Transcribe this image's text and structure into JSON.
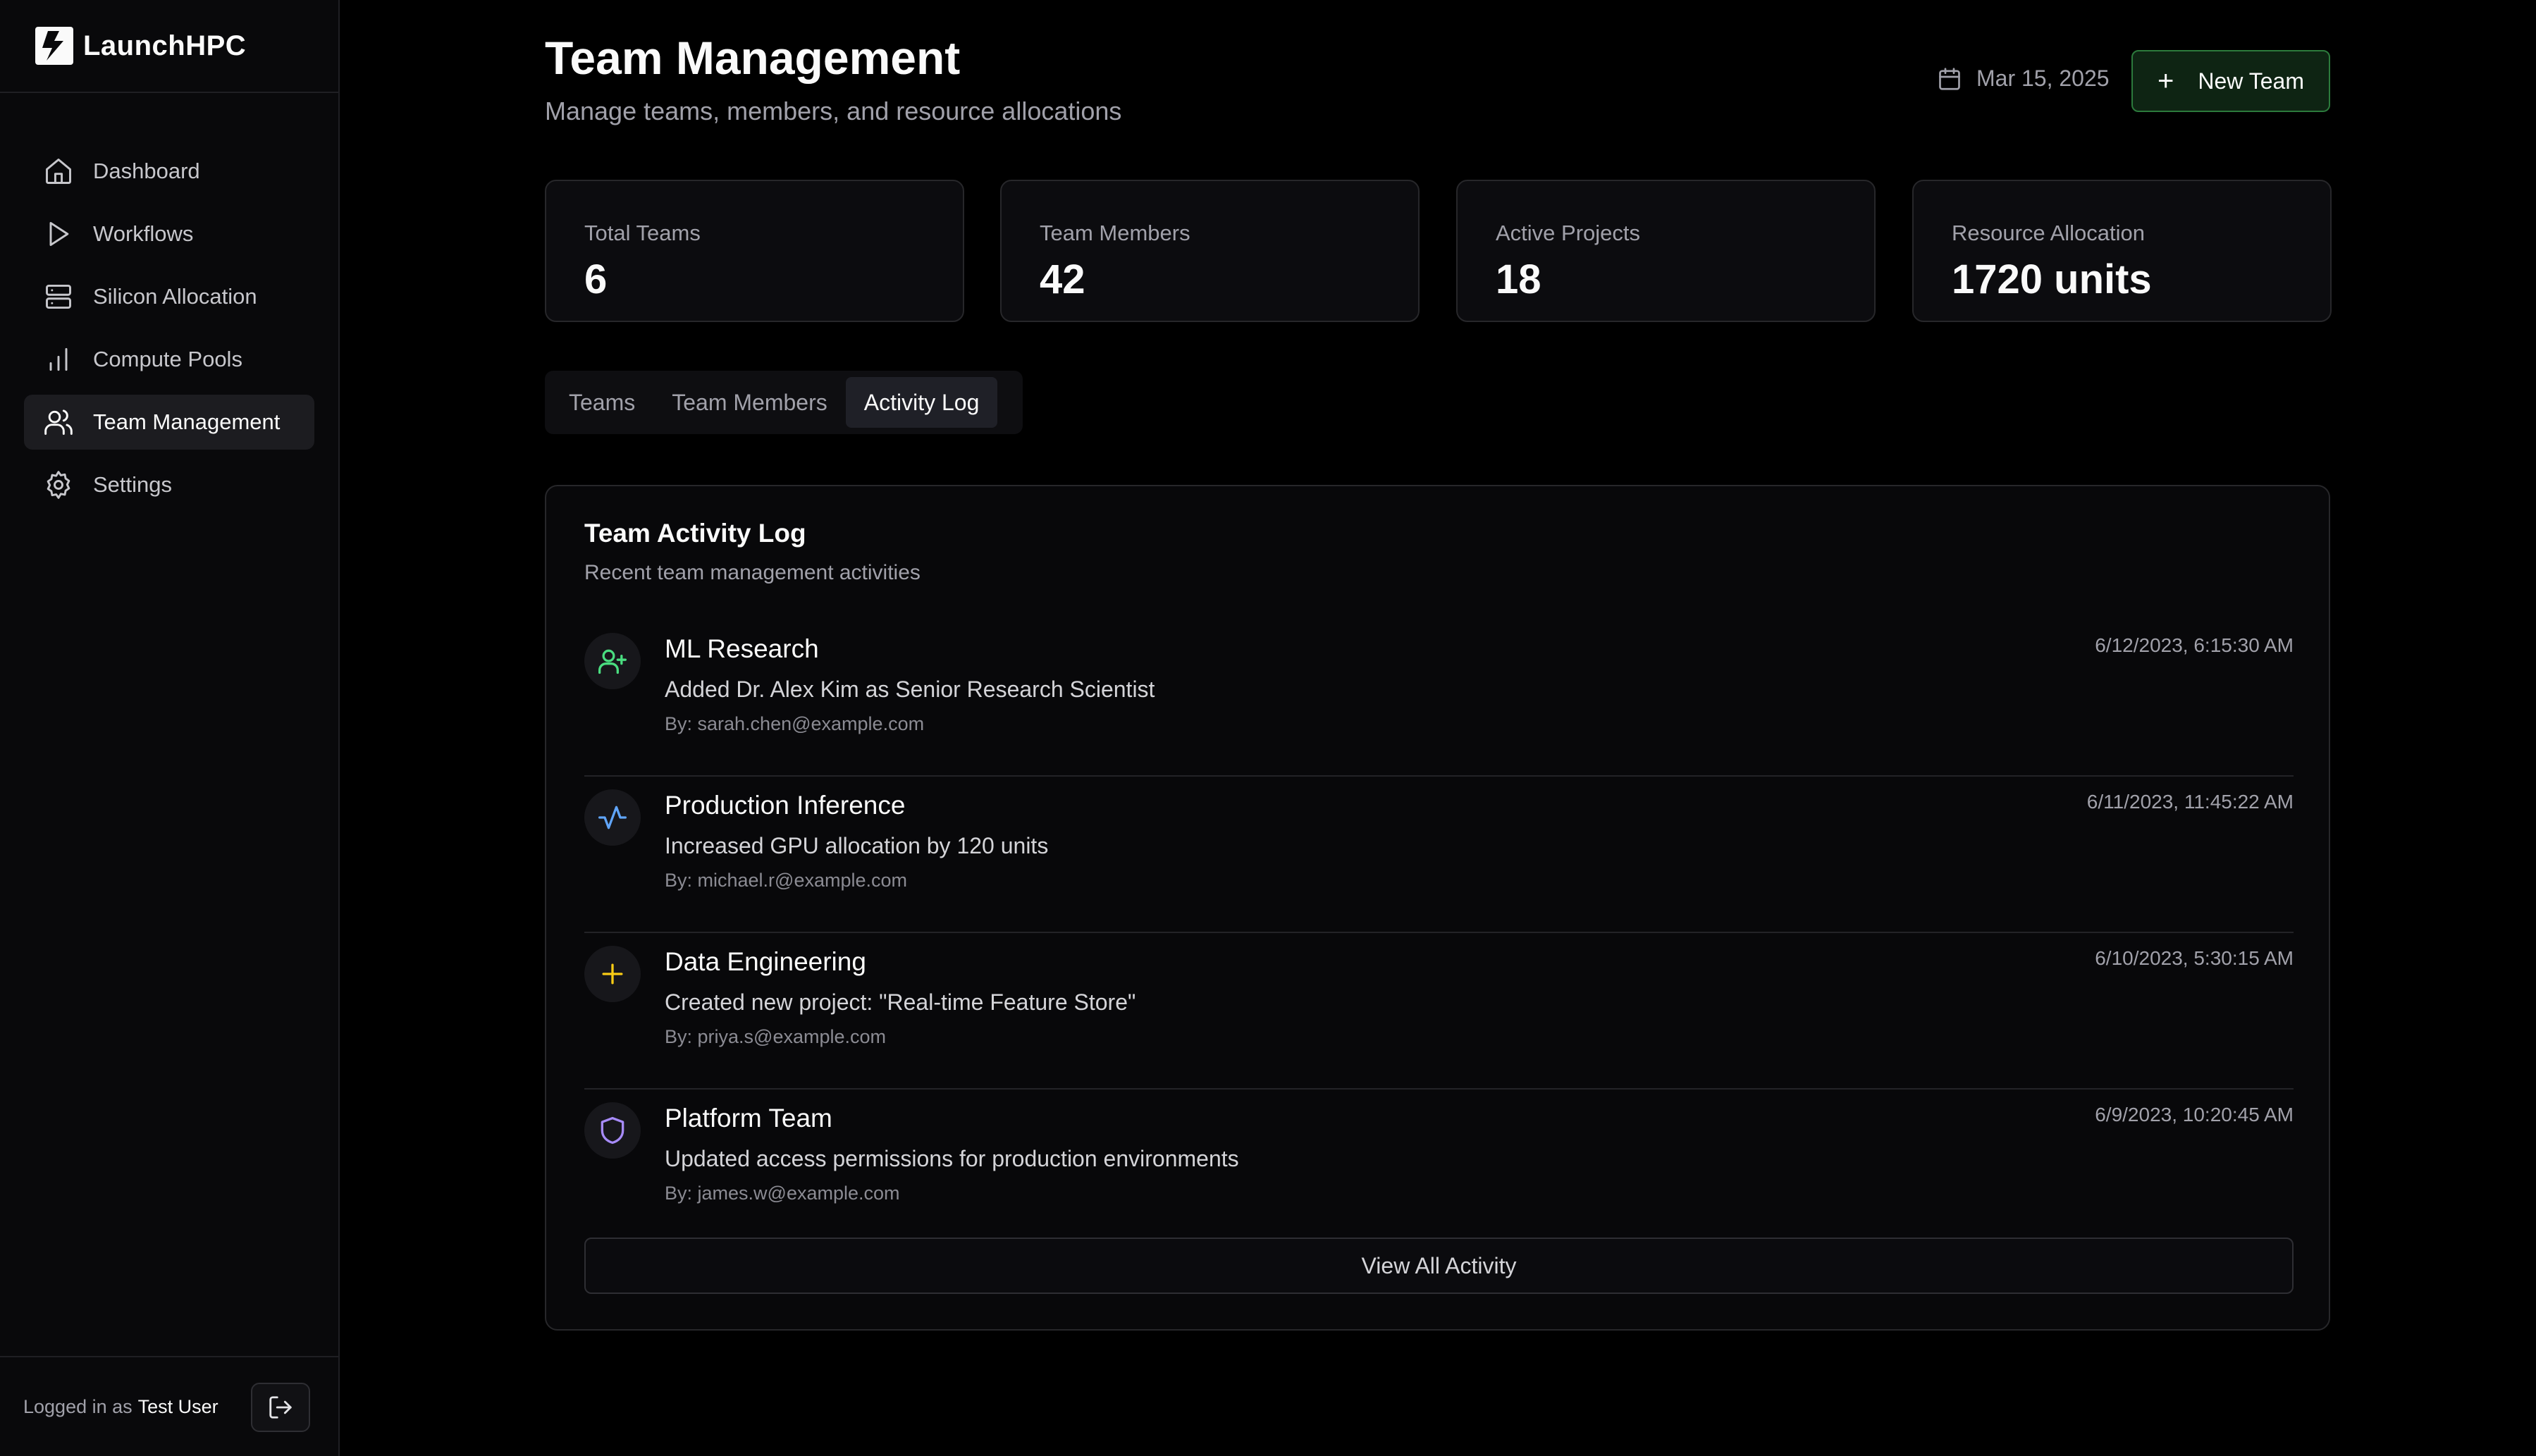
{
  "brand": {
    "name": "LaunchHPC"
  },
  "sidebar": {
    "items": [
      {
        "label": "Dashboard",
        "icon": "home-icon",
        "active": false
      },
      {
        "label": "Workflows",
        "icon": "play-icon",
        "active": false
      },
      {
        "label": "Silicon Allocation",
        "icon": "server-icon",
        "active": false
      },
      {
        "label": "Compute Pools",
        "icon": "bar-chart-icon",
        "active": false
      },
      {
        "label": "Team Management",
        "icon": "users-icon",
        "active": true
      },
      {
        "label": "Settings",
        "icon": "gear-icon",
        "active": false
      }
    ],
    "footer": {
      "prefix": "Logged in as",
      "user": "Test User"
    }
  },
  "header": {
    "title": "Team Management",
    "subtitle": "Manage teams, members, and resource allocations",
    "date": "Mar 15, 2025",
    "new_team_label": "New Team"
  },
  "stats": [
    {
      "label": "Total Teams",
      "value": "6"
    },
    {
      "label": "Team Members",
      "value": "42"
    },
    {
      "label": "Active Projects",
      "value": "18"
    },
    {
      "label": "Resource Allocation",
      "value": "1720 units"
    }
  ],
  "tabs": [
    {
      "label": "Teams",
      "active": false
    },
    {
      "label": "Team Members",
      "active": false
    },
    {
      "label": "Activity Log",
      "active": true
    }
  ],
  "activity": {
    "title": "Team Activity Log",
    "subtitle": "Recent team management activities",
    "items": [
      {
        "team": "ML Research",
        "description": "Added Dr. Alex Kim as Senior Research Scientist",
        "by": "By: sarah.chen@example.com",
        "time": "6/12/2023, 6:15:30 AM",
        "icon": "user-plus-icon",
        "color": "#4ade80"
      },
      {
        "team": "Production Inference",
        "description": "Increased GPU allocation by 120 units",
        "by": "By: michael.r@example.com",
        "time": "6/11/2023, 11:45:22 AM",
        "icon": "activity-icon",
        "color": "#60a5fa"
      },
      {
        "team": "Data Engineering",
        "description": "Created new project: \"Real-time Feature Store\"",
        "by": "By: priya.s@example.com",
        "time": "6/10/2023, 5:30:15 AM",
        "icon": "plus-icon",
        "color": "#facc15"
      },
      {
        "team": "Platform Team",
        "description": "Updated access permissions for production environments",
        "by": "By: james.w@example.com",
        "time": "6/9/2023, 10:20:45 AM",
        "icon": "shield-icon",
        "color": "#a78bfa"
      }
    ],
    "view_all_label": "View All Activity"
  },
  "colors": {
    "background": "#000000",
    "sidebar": "#09090b",
    "accent_green": "#2c7a3c",
    "text_primary": "#fafafa",
    "text_muted": "#a1a1aa"
  }
}
